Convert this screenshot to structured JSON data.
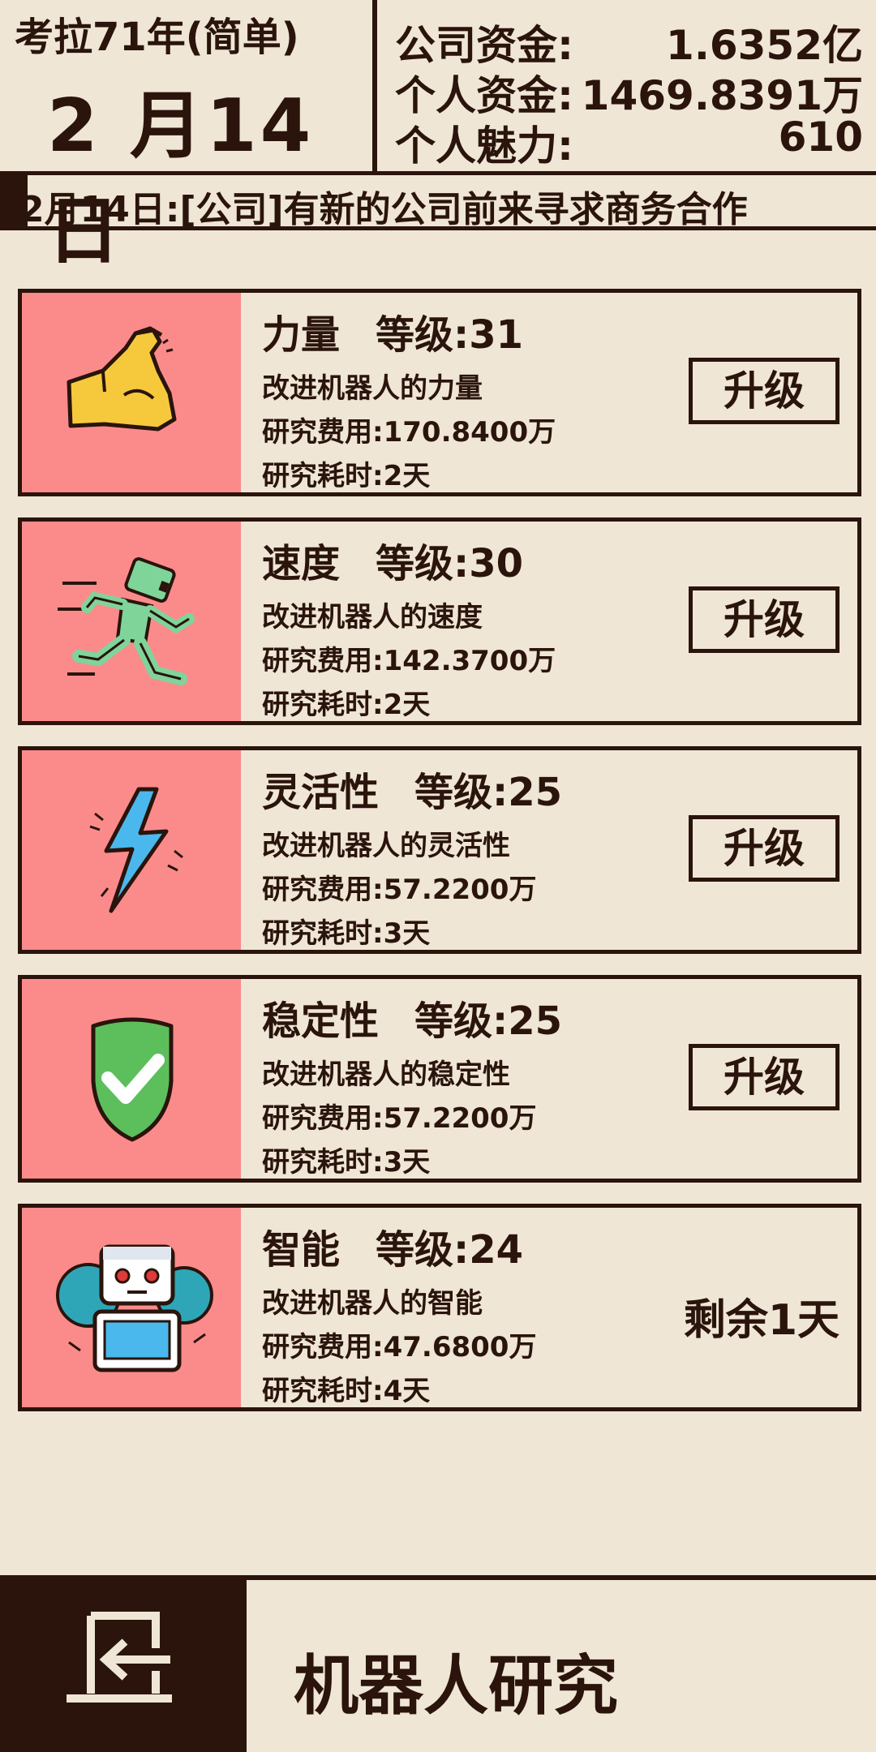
{
  "header": {
    "year_label": "考拉71年(简单)",
    "date": "2 月14 日",
    "company_funds_label": "公司资金:",
    "company_funds_value": "1.6352亿",
    "personal_funds_label": "个人资金:",
    "personal_funds_value": "1469.8391万",
    "charm_label": "个人魅力:",
    "charm_value": "610"
  },
  "ticker": {
    "text": "2月14日:[公司]有新的公司前来寻求商务合作"
  },
  "cards": [
    {
      "name": "力量",
      "level": "等级:31",
      "desc": "改进机器人的力量",
      "cost": "研究费用:170.8400万",
      "time": "研究耗时:2天",
      "action": "升级",
      "icon": "muscle-arm-icon"
    },
    {
      "name": "速度",
      "level": "等级:30",
      "desc": "改进机器人的速度",
      "cost": "研究费用:142.3700万",
      "time": "研究耗时:2天",
      "action": "升级",
      "icon": "running-robot-icon"
    },
    {
      "name": "灵活性",
      "level": "等级:25",
      "desc": "改进机器人的灵活性",
      "cost": "研究费用:57.2200万",
      "time": "研究耗时:3天",
      "action": "升级",
      "icon": "lightning-icon"
    },
    {
      "name": "稳定性",
      "level": "等级:25",
      "desc": "改进机器人的稳定性",
      "cost": "研究费用:57.2200万",
      "time": "研究耗时:3天",
      "action": "升级",
      "icon": "shield-check-icon"
    },
    {
      "name": "智能",
      "level": "等级:24",
      "desc": "改进机器人的智能",
      "cost": "研究费用:47.6800万",
      "time": "研究耗时:4天",
      "remaining": "剩余1天",
      "icon": "robot-gear-icon"
    }
  ],
  "footer": {
    "title": "机器人研究",
    "exit_icon": "exit-door-icon"
  },
  "colors": {
    "dark": "#2a140c",
    "background": "#efe6d6",
    "icon_panel": "#fb8b8b"
  }
}
